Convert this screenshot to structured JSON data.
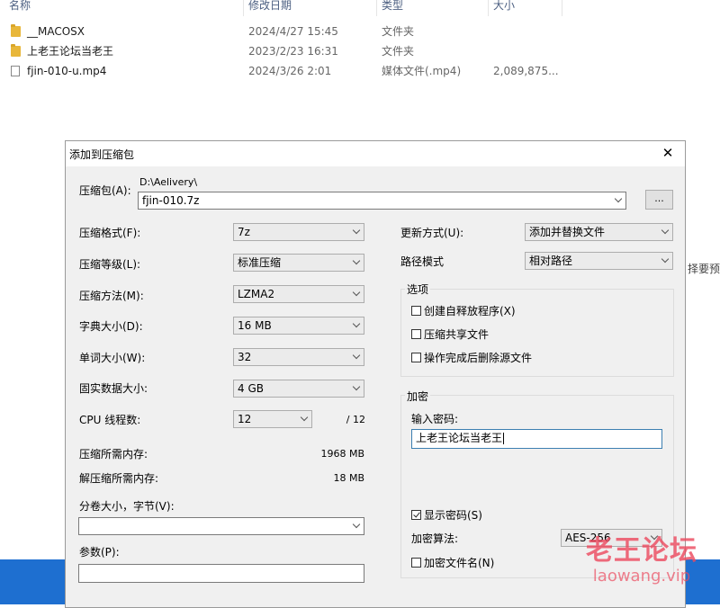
{
  "explorer": {
    "columns": [
      "名称",
      "修改日期",
      "类型",
      "大小"
    ],
    "rows": [
      {
        "icon": "folder-icon",
        "name": "__MACOSX",
        "date": "2024/4/27 15:45",
        "type": "文件夹",
        "size": ""
      },
      {
        "icon": "folder-icon",
        "name": "上老王论坛当老王",
        "date": "2023/2/23 16:31",
        "type": "文件夹",
        "size": ""
      },
      {
        "icon": "file-icon",
        "name": "fjin-010-u.mp4",
        "date": "2024/3/26 2:01",
        "type": "媒体文件(.mp4)",
        "size": "2,089,875..."
      }
    ],
    "background_fragment": "择要预"
  },
  "dialog": {
    "title": "添加到压缩包",
    "close_symbol": "✕",
    "archive": {
      "label": "压缩包(A):",
      "path": "D:\\Aelivery\\",
      "filename": "fjin-010.7z",
      "browse_label": "..."
    },
    "left": {
      "format": {
        "label": "压缩格式(F):",
        "value": "7z"
      },
      "level": {
        "label": "压缩等级(L):",
        "value": "标准压缩"
      },
      "method": {
        "label": "压缩方法(M):",
        "value": "LZMA2"
      },
      "dict": {
        "label": "字典大小(D):",
        "value": "16 MB"
      },
      "word": {
        "label": "单词大小(W):",
        "value": "32"
      },
      "solid": {
        "label": "固实数据大小:",
        "value": "4 GB"
      },
      "threads": {
        "label": "CPU 线程数:",
        "value": "12",
        "max": "/ 12"
      },
      "mem_compress": {
        "label": "压缩所需内存:",
        "value": "1968 MB"
      },
      "mem_decompress": {
        "label": "解压缩所需内存:",
        "value": "18 MB"
      },
      "volume": {
        "label": "分卷大小，字节(V):",
        "value": ""
      },
      "params": {
        "label": "参数(P):",
        "value": ""
      }
    },
    "right": {
      "update": {
        "label": "更新方式(U):",
        "value": "添加并替换文件"
      },
      "path_mode": {
        "label": "路径模式",
        "value": "相对路径"
      },
      "options": {
        "title": "选项",
        "sfx": {
          "label": "创建自释放程序(X)",
          "checked": false
        },
        "shared": {
          "label": "压缩共享文件",
          "checked": false
        },
        "delete": {
          "label": "操作完成后删除源文件",
          "checked": false
        }
      },
      "encryption": {
        "title": "加密",
        "password_label": "输入密码:",
        "password_value": "上老王论坛当老王",
        "show_password": {
          "label": "显示密码(S)",
          "checked": true
        },
        "method_label": "加密算法:",
        "method_value": "AES-256",
        "encrypt_names": {
          "label": "加密文件名(N)",
          "checked": false
        }
      }
    }
  },
  "watermark": {
    "cn": "老王论坛",
    "en": "laowang.vip"
  },
  "colors": {
    "taskbar": "#1e6fd0",
    "watermark": "#eb4b5f"
  }
}
